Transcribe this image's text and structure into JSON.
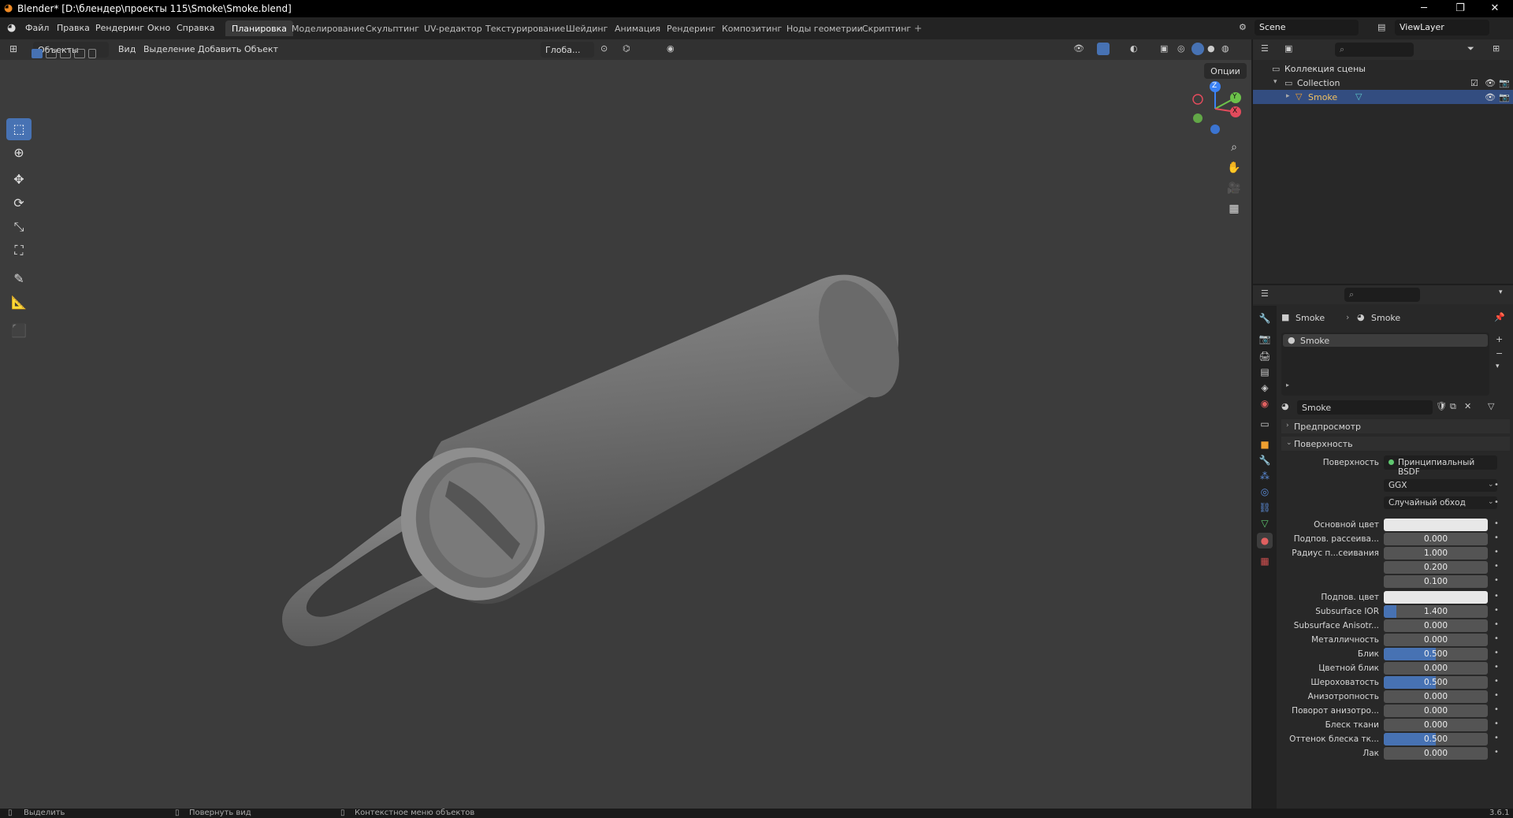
{
  "titlebar": {
    "title": "Blender* [D:\\блендер\\проекты 115\\Smoke\\Smoke.blend]",
    "minimize": "─",
    "restore": "❐",
    "close": "✕"
  },
  "menu": {
    "items": [
      "Файл",
      "Правка",
      "Рендеринг",
      "Окно",
      "Справка"
    ]
  },
  "workspaces": [
    "Планировка",
    "Моделирование",
    "Скульптинг",
    "UV-редактор",
    "Текстурирование",
    "Шейдинг",
    "Анимация",
    "Рендеринг",
    "Композитинг",
    "Ноды геометрии",
    "Скриптинг"
  ],
  "workspace_add": "+",
  "scene": {
    "name": "Scene",
    "view_layer": "ViewLayer"
  },
  "viewport": {
    "mode": "Объекты",
    "menus": [
      "Вид",
      "Выделение",
      "Добавить",
      "Объект"
    ],
    "orientation": "Глоба...",
    "options": "Опции",
    "gizmo": {
      "z": "Z",
      "y": "Y",
      "x": "X"
    }
  },
  "outliner": {
    "root": "Коллекция сцены",
    "collection": "Collection",
    "object": "Smoke"
  },
  "properties": {
    "breadcrumb": [
      "Smoke",
      "Smoke"
    ],
    "slot": "Smoke",
    "material_name": "Smoke",
    "panels": {
      "preview": "Предпросмотр",
      "surface": "Поверхность"
    },
    "surface_label": "Поверхность",
    "surface_value": "Принципиальный BSDF",
    "distribution": "GGX",
    "subsurface_method": "Случайный обход",
    "rows": [
      {
        "label": "Основной цвет",
        "value": "",
        "type": "color",
        "dot": "yellow"
      },
      {
        "label": "Подпов. рассеива...",
        "value": "0.000",
        "fill": 0,
        "dot": "gray"
      },
      {
        "label": "Радиус п...сеивания",
        "value": "1.000",
        "fill": 0,
        "dot": "blue"
      },
      {
        "label": "",
        "value": "0.200",
        "fill": 0,
        "dot": ""
      },
      {
        "label": "",
        "value": "0.100",
        "fill": 0,
        "dot": ""
      },
      {
        "label": "Подпов. цвет",
        "value": "",
        "type": "color",
        "dot": "yellow"
      },
      {
        "label": "Subsurface IOR",
        "value": "1.400",
        "fill": 0.12,
        "dot": "gray"
      },
      {
        "label": "Subsurface Anisotr...",
        "value": "0.000",
        "fill": 0,
        "dot": "gray"
      },
      {
        "label": "Металличность",
        "value": "0.000",
        "fill": 0,
        "dot": "gray"
      },
      {
        "label": "Блик",
        "value": "0.500",
        "fill": 0.5,
        "dot": "gray"
      },
      {
        "label": "Цветной блик",
        "value": "0.000",
        "fill": 0,
        "dot": "gray"
      },
      {
        "label": "Шероховатость",
        "value": "0.500",
        "fill": 0.5,
        "dot": "gray"
      },
      {
        "label": "Анизотропность",
        "value": "0.000",
        "fill": 0,
        "dot": "gray"
      },
      {
        "label": "Поворот анизотро...",
        "value": "0.000",
        "fill": 0,
        "dot": "gray"
      },
      {
        "label": "Блеск ткани",
        "value": "0.000",
        "fill": 0,
        "dot": "gray"
      },
      {
        "label": "Оттенок блеска тк...",
        "value": "0.500",
        "fill": 0.5,
        "dot": "gray"
      },
      {
        "label": "Лак",
        "value": "0.000",
        "fill": 0,
        "dot": "gray"
      }
    ]
  },
  "statusbar": {
    "select": "Выделить",
    "rotate": "Повернуть вид",
    "context": "Контекстное меню объектов",
    "version": "3.6.1"
  },
  "colors": {
    "accent": "#4772b3",
    "viewport_bg": "#3c3c3c",
    "panel_bg": "#282828"
  }
}
